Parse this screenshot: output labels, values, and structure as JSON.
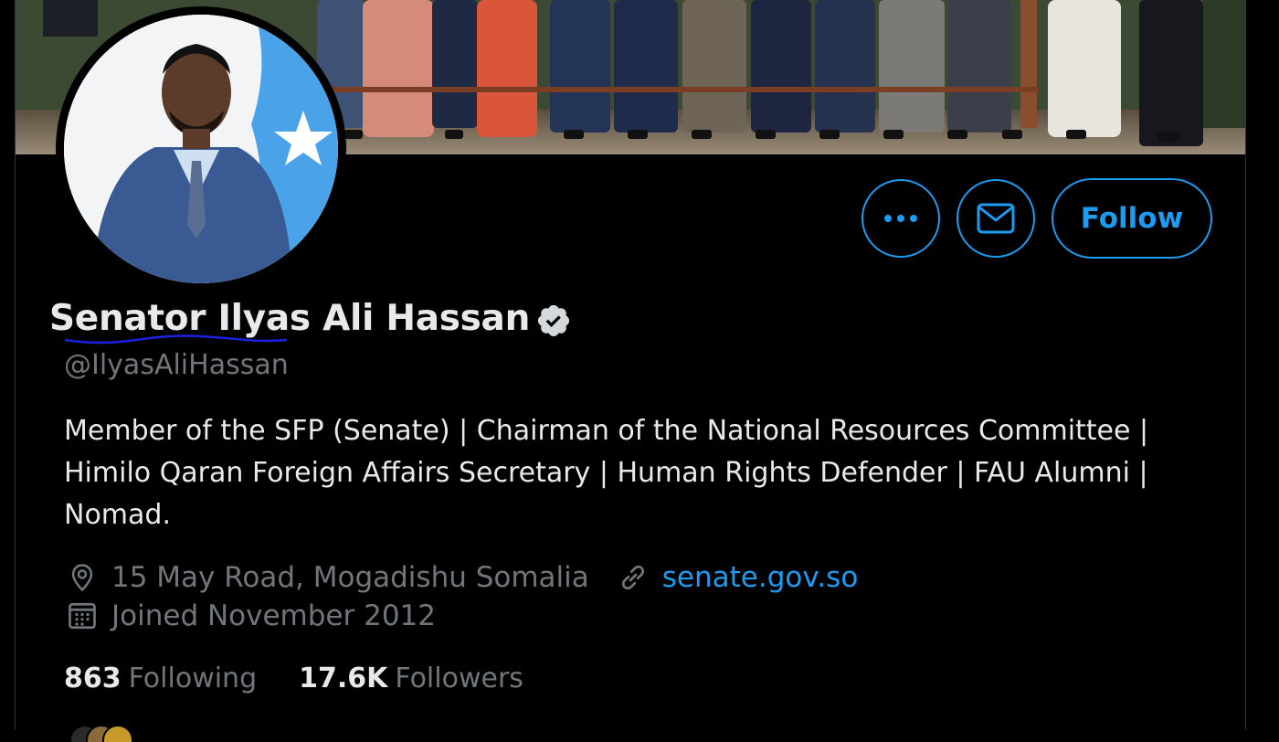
{
  "profile": {
    "display_name": "Senator Ilyas Ali Hassan",
    "handle": "@IlyasAliHassan",
    "bio_lines": [
      "Member of the SFP (Senate) | Chairman of the National Resources Committee |",
      "Himilo Qaran Foreign Affairs Secretary | Human Rights Defender | FAU Alumni |",
      "Nomad."
    ],
    "location": "15 May Road, Mogadishu Somalia",
    "website": "senate.gov.so",
    "joined": "Joined November 2012",
    "verified": true
  },
  "actions": {
    "more_icon": "more-horizontal-icon",
    "message_icon": "envelope-icon",
    "follow_label": "Follow"
  },
  "stats": {
    "following_count": "863",
    "following_label": "Following",
    "followers_count": "17.6K",
    "followers_label": "Followers"
  },
  "colors": {
    "accent": "#1d9bf0",
    "text_primary": "#e7e9ea",
    "text_secondary": "#71767b",
    "background": "#000000",
    "spellcheck_underline": "#1a22e0"
  }
}
